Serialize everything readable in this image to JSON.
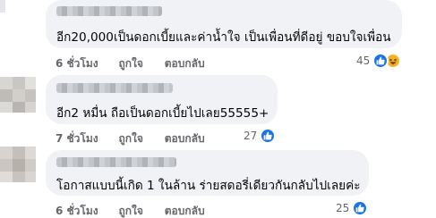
{
  "comments": [
    {
      "text": "อีก20,000เป็นดอกเบี้ยและค่าน้ำใจ เป็นเพื่อนที่ดีอยู่ ขอบใจเพื่อน",
      "time": "6 ชั่วโมง",
      "like_label": "ถูกใจ",
      "reply_label": "ตอบกลับ",
      "reaction_count": "45",
      "reactions": [
        "like-icon",
        "laugh-icon"
      ]
    },
    {
      "text": "อีก2 หมื่น ถือเป็นดอกเบี้ยไปเลย55555+",
      "time": "7 ชั่วโมง",
      "like_label": "ถูกใจ",
      "reply_label": "ตอบกลับ",
      "reaction_count": "27",
      "reactions": [
        "like-icon"
      ]
    },
    {
      "text": "โอกาสแบบนี้เกิด 1 ในล้าน ร่ายสดอรี่เดียวกันกลับไปเลยค่ะ",
      "time": "6 ชั่วโมง",
      "like_label": "ถูกใจ",
      "reply_label": "ตอบกลับ",
      "reaction_count": "25",
      "reactions": [
        "like-icon"
      ]
    }
  ],
  "colors": {
    "bubble": "#f0f2f5",
    "meta_text": "#65676b",
    "like_blue": "#1b74e4",
    "laugh_yellow": "#f7b125"
  }
}
